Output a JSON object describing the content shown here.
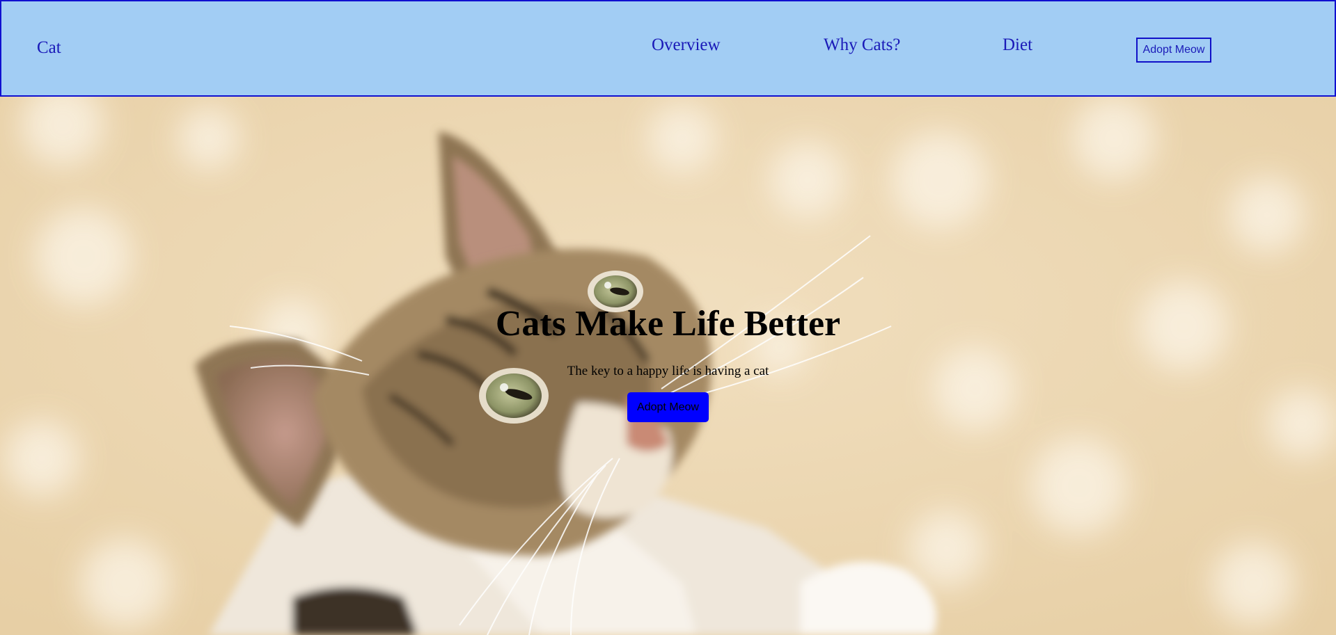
{
  "nav": {
    "logo": "Cat",
    "links": [
      {
        "label": "Overview"
      },
      {
        "label": "Why Cats?"
      },
      {
        "label": "Diet"
      }
    ],
    "cta_label": "Adopt Meow"
  },
  "hero": {
    "title": "Cats Make Life Better",
    "subtitle": "The key to a happy life is having a cat",
    "cta_label": "Adopt Meow",
    "image": "kitten-looking-up-photo"
  },
  "colors": {
    "nav_background": "#a2cdf4",
    "nav_border": "#1010d0",
    "nav_text": "#1a1ab8",
    "hero_button": "#0000ff",
    "hero_background": "#ecd9b6"
  }
}
